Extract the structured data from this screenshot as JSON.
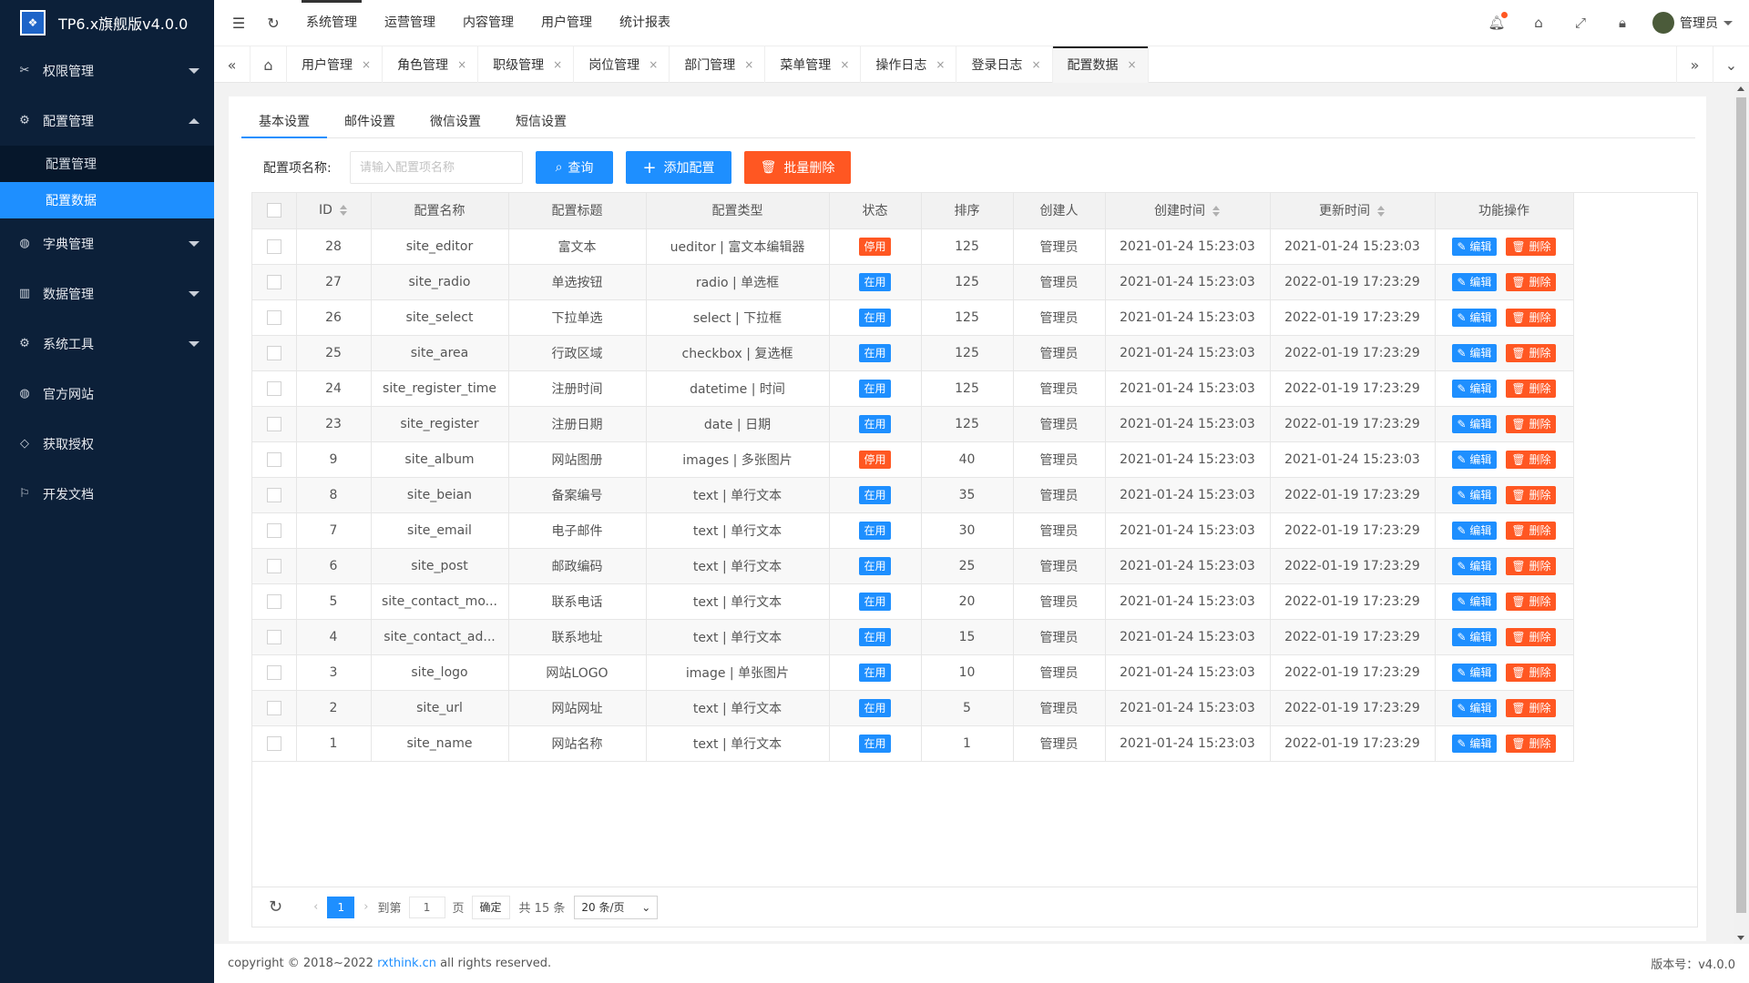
{
  "app": {
    "title": "TP6.x旗舰版v4.0.0",
    "logo_icon": "logo-icon"
  },
  "colors": {
    "accent": "#1e8fff",
    "danger": "#ff5722",
    "sidebar": "#0c2039"
  },
  "sidebar": {
    "items": [
      {
        "label": "权限管理",
        "icon": "scissors-icon",
        "expanded": false
      },
      {
        "label": "配置管理",
        "icon": "gear-icon",
        "expanded": true
      },
      {
        "label": "字典管理",
        "icon": "globe-icon",
        "expanded": false
      },
      {
        "label": "数据管理",
        "icon": "book-icon",
        "expanded": false
      },
      {
        "label": "系统工具",
        "icon": "gear-icon",
        "expanded": false
      },
      {
        "label": "官方网站",
        "icon": "globe-icon"
      },
      {
        "label": "获取授权",
        "icon": "diamond-icon"
      },
      {
        "label": "开发文档",
        "icon": "flag-icon"
      }
    ],
    "subitems": [
      {
        "label": "配置管理",
        "active": false
      },
      {
        "label": "配置数据",
        "active": true
      }
    ]
  },
  "topnav": {
    "items": [
      "系统管理",
      "运营管理",
      "内容管理",
      "用户管理",
      "统计报表"
    ],
    "active": 0,
    "user": "管理员"
  },
  "tabs": {
    "items": [
      "用户管理",
      "角色管理",
      "职级管理",
      "岗位管理",
      "部门管理",
      "菜单管理",
      "操作日志",
      "登录日志",
      "配置数据"
    ],
    "active": 8,
    "close": "×"
  },
  "subtabs": {
    "items": [
      "基本设置",
      "邮件设置",
      "微信设置",
      "短信设置"
    ],
    "active": 0
  },
  "filter": {
    "label": "配置项名称:",
    "placeholder": "请输入配置项名称",
    "query": "查询",
    "add": "添加配置",
    "batch_delete": "批量删除"
  },
  "table": {
    "headers": [
      "ID",
      "配置名称",
      "配置标题",
      "配置类型",
      "状态",
      "排序",
      "创建人",
      "创建时间",
      "更新时间",
      "功能操作"
    ],
    "edit_label": "编辑",
    "delete_label": "删除",
    "rows": [
      {
        "id": "28",
        "name": "site_editor",
        "title": "富文本",
        "type": "ueditor | 富文本编辑器",
        "status": "停用",
        "sort": "125",
        "creator": "管理员",
        "created": "2021-01-24 15:23:03",
        "updated": "2021-01-24 15:23:03"
      },
      {
        "id": "27",
        "name": "site_radio",
        "title": "单选按钮",
        "type": "radio | 单选框",
        "status": "在用",
        "sort": "125",
        "creator": "管理员",
        "created": "2021-01-24 15:23:03",
        "updated": "2022-01-19 17:23:29"
      },
      {
        "id": "26",
        "name": "site_select",
        "title": "下拉单选",
        "type": "select | 下拉框",
        "status": "在用",
        "sort": "125",
        "creator": "管理员",
        "created": "2021-01-24 15:23:03",
        "updated": "2022-01-19 17:23:29"
      },
      {
        "id": "25",
        "name": "site_area",
        "title": "行政区域",
        "type": "checkbox | 复选框",
        "status": "在用",
        "sort": "125",
        "creator": "管理员",
        "created": "2021-01-24 15:23:03",
        "updated": "2022-01-19 17:23:29"
      },
      {
        "id": "24",
        "name": "site_register_time",
        "title": "注册时间",
        "type": "datetime | 时间",
        "status": "在用",
        "sort": "125",
        "creator": "管理员",
        "created": "2021-01-24 15:23:03",
        "updated": "2022-01-19 17:23:29"
      },
      {
        "id": "23",
        "name": "site_register",
        "title": "注册日期",
        "type": "date | 日期",
        "status": "在用",
        "sort": "125",
        "creator": "管理员",
        "created": "2021-01-24 15:23:03",
        "updated": "2022-01-19 17:23:29"
      },
      {
        "id": "9",
        "name": "site_album",
        "title": "网站图册",
        "type": "images | 多张图片",
        "status": "停用",
        "sort": "40",
        "creator": "管理员",
        "created": "2021-01-24 15:23:03",
        "updated": "2021-01-24 15:23:03"
      },
      {
        "id": "8",
        "name": "site_beian",
        "title": "备案编号",
        "type": "text | 单行文本",
        "status": "在用",
        "sort": "35",
        "creator": "管理员",
        "created": "2021-01-24 15:23:03",
        "updated": "2022-01-19 17:23:29"
      },
      {
        "id": "7",
        "name": "site_email",
        "title": "电子邮件",
        "type": "text | 单行文本",
        "status": "在用",
        "sort": "30",
        "creator": "管理员",
        "created": "2021-01-24 15:23:03",
        "updated": "2022-01-19 17:23:29"
      },
      {
        "id": "6",
        "name": "site_post",
        "title": "邮政编码",
        "type": "text | 单行文本",
        "status": "在用",
        "sort": "25",
        "creator": "管理员",
        "created": "2021-01-24 15:23:03",
        "updated": "2022-01-19 17:23:29"
      },
      {
        "id": "5",
        "name": "site_contact_mo...",
        "title": "联系电话",
        "type": "text | 单行文本",
        "status": "在用",
        "sort": "20",
        "creator": "管理员",
        "created": "2021-01-24 15:23:03",
        "updated": "2022-01-19 17:23:29"
      },
      {
        "id": "4",
        "name": "site_contact_ad...",
        "title": "联系地址",
        "type": "text | 单行文本",
        "status": "在用",
        "sort": "15",
        "creator": "管理员",
        "created": "2021-01-24 15:23:03",
        "updated": "2022-01-19 17:23:29"
      },
      {
        "id": "3",
        "name": "site_logo",
        "title": "网站LOGO",
        "type": "image | 单张图片",
        "status": "在用",
        "sort": "10",
        "creator": "管理员",
        "created": "2021-01-24 15:23:03",
        "updated": "2022-01-19 17:23:29"
      },
      {
        "id": "2",
        "name": "site_url",
        "title": "网站网址",
        "type": "text | 单行文本",
        "status": "在用",
        "sort": "5",
        "creator": "管理员",
        "created": "2021-01-24 15:23:03",
        "updated": "2022-01-19 17:23:29"
      },
      {
        "id": "1",
        "name": "site_name",
        "title": "网站名称",
        "type": "text | 单行文本",
        "status": "在用",
        "sort": "1",
        "creator": "管理员",
        "created": "2021-01-24 15:23:03",
        "updated": "2022-01-19 17:23:29"
      }
    ]
  },
  "pager": {
    "current": "1",
    "goto_label": "到第",
    "goto_value": "1",
    "page_unit": "页",
    "confirm": "确定",
    "total": "共 15 条",
    "page_size": "20 条/页"
  },
  "footer": {
    "prefix": "copyright © 2018~2022",
    "link": "rxthink.cn",
    "suffix": "all rights reserved.",
    "version": "版本号：v4.0.0"
  }
}
